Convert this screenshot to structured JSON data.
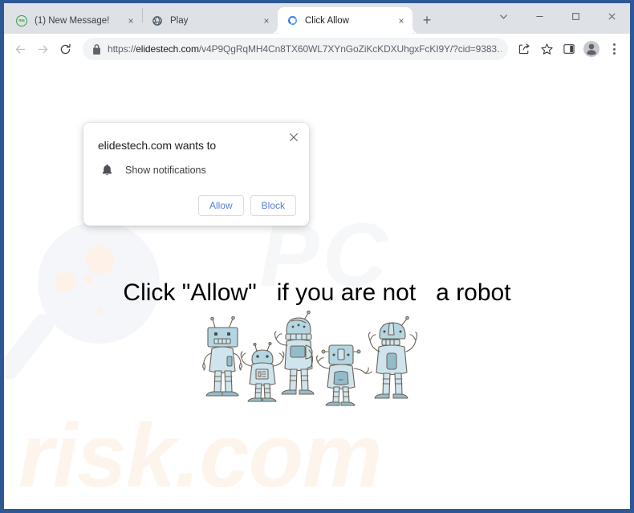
{
  "window": {
    "controls": [
      {
        "name": "tab-search",
        "glyph": "chevron-down"
      },
      {
        "name": "minimize",
        "glyph": "minimize"
      },
      {
        "name": "maximize",
        "glyph": "maximize"
      },
      {
        "name": "close",
        "glyph": "close"
      }
    ]
  },
  "tabs": [
    {
      "title": "(1) New Message!",
      "favicon": "ms-circle-icon",
      "active": false,
      "close_label": "×"
    },
    {
      "title": "Play",
      "favicon": "globe-icon",
      "active": false,
      "close_label": "×"
    },
    {
      "title": "Click Allow",
      "favicon": "chrome-reload-icon",
      "active": true,
      "close_label": "×"
    }
  ],
  "new_tab_label": "+",
  "toolbar": {
    "back_label": "Back",
    "forward_label": "Forward",
    "reload_label": "Reload",
    "url_scheme": "https://",
    "url_domain": "elidestech.com",
    "url_path": "/v4P9QgRqMH4Cn8TX60WL7XYnGoZiKcKDXUhgxFcKI9Y/?cid=9383…",
    "url_full": "https://elidestech.com/v4P9QgRqMH4Cn8TX60WL7XYnGoZiKcKDXUhgxFcKI9Y/?cid=9383…",
    "share_label": "Share this page",
    "bookmark_label": "Bookmark this tab",
    "side_panel_label": "Side panel",
    "profile_label": "Profile",
    "menu_label": "Customize and control Google Chrome"
  },
  "permission_dialog": {
    "title": "elidestech.com wants to",
    "permission_label": "Show notifications",
    "permission_icon": "bell-icon",
    "allow_label": "Allow",
    "block_label": "Block",
    "close_label": "×"
  },
  "page": {
    "headline": "Click \"Allow\"   if you are not   a robot",
    "robots_alt": "five cartoon robots",
    "watermark_top": "PC",
    "watermark_bottom": "risk.com"
  },
  "colors": {
    "window_frame": "#2d5894",
    "tabstrip": "#dee1e6",
    "omnibox": "#f1f3f4",
    "link_blue": "#5b7fd4",
    "text_primary": "#202124",
    "text_secondary": "#5f6368",
    "watermark_gray": "#f6f7f8",
    "watermark_peach": "#fdf4ec",
    "robot_body": "#aed3df"
  }
}
